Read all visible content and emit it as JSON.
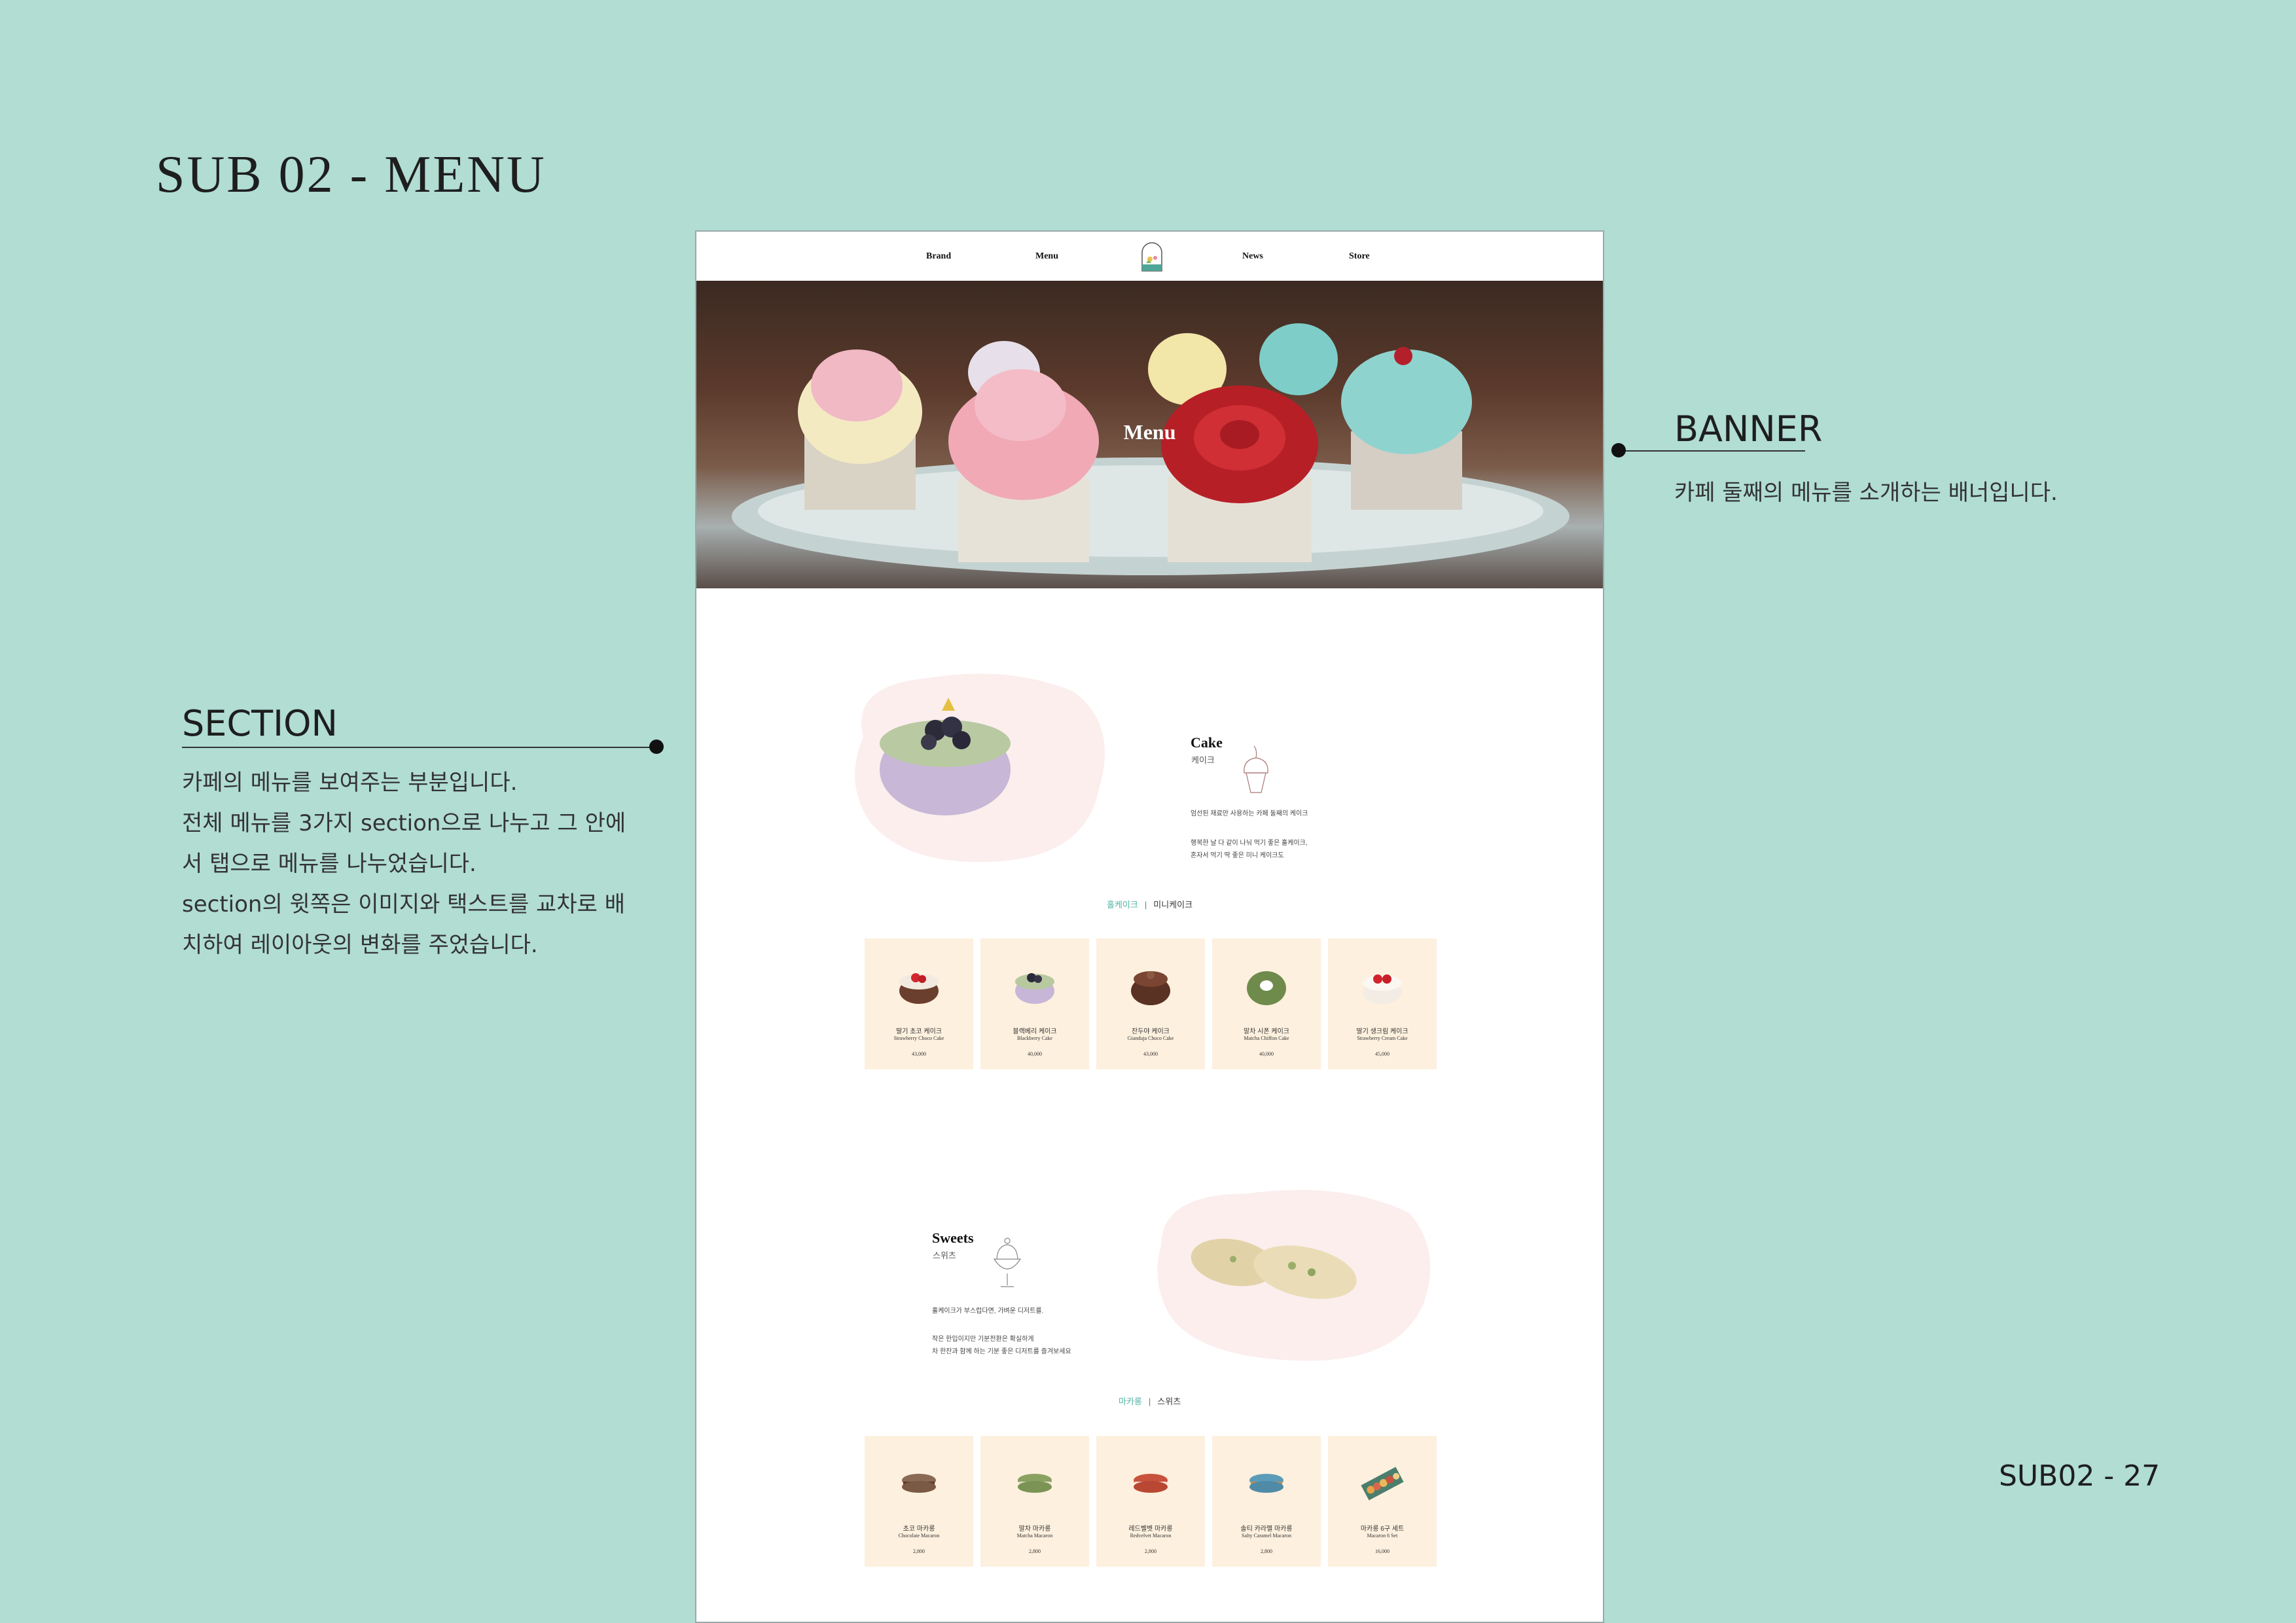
{
  "page": {
    "title": "SUB 02 - MENU",
    "number": "SUB02 - 27"
  },
  "annotations": {
    "banner": {
      "title": "BANNER",
      "text": "카페 둘째의 메뉴를 소개하는 배너입니다."
    },
    "section": {
      "title": "SECTION",
      "lines": [
        "카페의 메뉴를 보여주는 부분입니다.",
        "전체 메뉴를 3가지 section으로 나누고 그 안에",
        "서 탭으로 메뉴를 나누었습니다.",
        "section의 윗쪽은 이미지와 택스트를 교차로 배",
        "치하여 레이아웃의 변화를 주었습니다."
      ]
    }
  },
  "site": {
    "nav": [
      "Brand",
      "Menu",
      "News",
      "Store"
    ],
    "banner_title": "Menu",
    "cake": {
      "title": "Cake",
      "subtitle": "케이크",
      "desc1": "엄선된 재료만 사용하는 카페 둘째의 케이크",
      "desc2": "행복한 날 다 같이 나눠 먹기 좋은 홀케이크,\n혼자서 먹기 딱 좋은 미니 케이크도",
      "tabs": [
        "홀케이크",
        "미니케이크"
      ],
      "items": [
        {
          "ko": "딸기 초코 케이크",
          "en": "Strawberry Choco Cake",
          "price": "43,000"
        },
        {
          "ko": "블랙베리 케이크",
          "en": "Blackberry Cake",
          "price": "40,000"
        },
        {
          "ko": "잔두야 케이크",
          "en": "Gianduja Choco Cake",
          "price": "43,000"
        },
        {
          "ko": "말차 시폰 케이크",
          "en": "Matcha Chiffon Cake",
          "price": "40,000"
        },
        {
          "ko": "딸기 생크림 케이크",
          "en": "Strawberry Cream Cake",
          "price": "45,000"
        }
      ]
    },
    "sweets": {
      "title": "Sweets",
      "subtitle": "스위츠",
      "desc1": "홀케이크가 부스럽다면, 가벼운 디저트를.",
      "desc2": "작은 한입이지만 기분전환은 확실하게\n차 한잔과 함께 하는 기분 좋은 디저트를 즐겨보세요",
      "tabs": [
        "마카롱",
        "스위츠"
      ],
      "items": [
        {
          "ko": "초코 마카롱",
          "en": "Chocolate Macaron",
          "price": "2,800"
        },
        {
          "ko": "말차 마카롱",
          "en": "Matcha Macaron",
          "price": "2,800"
        },
        {
          "ko": "레드벨벳 마카롱",
          "en": "Redvelvet Macaron",
          "price": "2,800"
        },
        {
          "ko": "솔티 카라멜 마카롱",
          "en": "Salty Caramel Macaron",
          "price": "2,800"
        },
        {
          "ko": "마카롱 6구 세트",
          "en": "Macaron 6 Set",
          "price": "16,000"
        }
      ]
    }
  }
}
